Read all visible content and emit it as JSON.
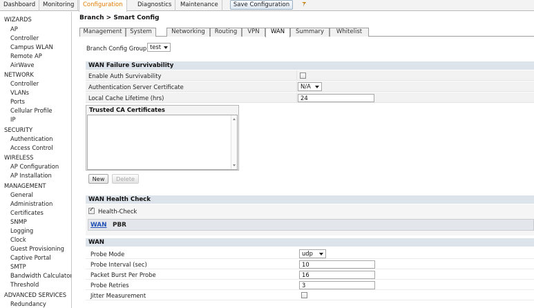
{
  "topnav": {
    "tabs": [
      "Dashboard",
      "Monitoring",
      "Configuration",
      "Diagnostics",
      "Maintenance"
    ],
    "active": "Configuration",
    "save_label": "Save Configuration",
    "pin_icon": "pin-icon"
  },
  "sidebar": {
    "wizards": {
      "title": "WIZARDS",
      "items": [
        "AP",
        "Controller",
        "Campus WLAN",
        "Remote AP",
        "AirWave"
      ]
    },
    "network": {
      "title": "NETWORK",
      "items": [
        "Controller",
        "VLANs",
        "Ports",
        "Cellular Profile",
        "IP"
      ]
    },
    "security": {
      "title": "SECURITY",
      "items": [
        "Authentication",
        "Access Control"
      ]
    },
    "wireless": {
      "title": "WIRELESS",
      "items": [
        "AP Configuration",
        "AP Installation"
      ]
    },
    "management": {
      "title": "MANAGEMENT",
      "items": [
        "General",
        "Administration",
        "Certificates",
        "SNMP",
        "Logging",
        "Clock",
        "Guest Provisioning",
        "Captive Portal",
        "SMTP",
        "Bandwidth Calculator",
        "Threshold"
      ]
    },
    "advanced": {
      "title": "ADVANCED SERVICES",
      "items": [
        "Redundancy"
      ]
    }
  },
  "main": {
    "breadcrumb": "Branch > Smart Config",
    "subtabs": [
      "Management",
      "System",
      "Networking",
      "Routing",
      "VPN",
      "WAN",
      "Summary",
      "Whitelist"
    ],
    "active_subtab": "WAN",
    "config_group": {
      "label": "Branch Config Group",
      "value": "test"
    }
  },
  "wan_failure": {
    "title": "WAN Failure Survivability",
    "enable_auth_label": "Enable Auth Survivability",
    "enable_auth_checked": false,
    "auth_cert_label": "Authentication Server Certificate",
    "auth_cert_value": "N/A",
    "cache_lifetime_label": "Local Cache Lifetime (hrs)",
    "cache_lifetime_value": "24",
    "trusted_ca_title": "Trusted CA Certificates",
    "new_label": "New",
    "delete_label": "Delete"
  },
  "health": {
    "title": "WAN Health Check",
    "check_label": "Health-Check",
    "checked": true,
    "tabs": [
      "WAN",
      "PBR"
    ]
  },
  "wan": {
    "title": "WAN",
    "probe_mode_label": "Probe Mode",
    "probe_mode_value": "udp",
    "probe_interval_label": "Probe Interval (sec)",
    "probe_interval_value": "10",
    "packet_burst_label": "Packet Burst Per Probe",
    "packet_burst_value": "16",
    "probe_retries_label": "Probe Retries",
    "probe_retries_value": "3",
    "jitter_label": "Jitter Measurement",
    "jitter_checked": false
  },
  "colors": {
    "active_tab_text": "#e07b00",
    "inner_tab_active": "#1f4fb4",
    "section_header_bg": "#dde3ea"
  }
}
